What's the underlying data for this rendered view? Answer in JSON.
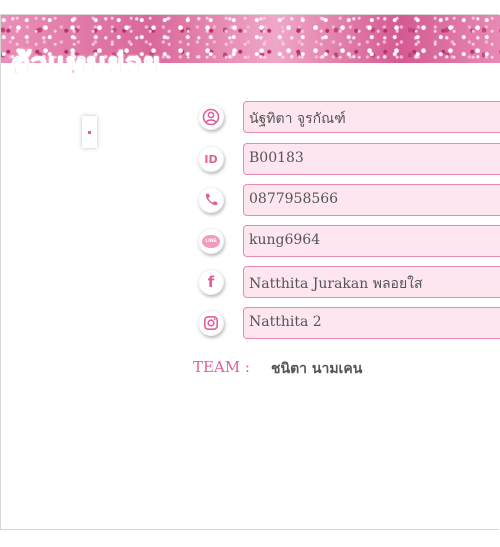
{
  "header": {
    "title": "ตัวแทนย่อย",
    "dot": "."
  },
  "colors": {
    "accent": "#e0609a",
    "field_bg": "#fde6ef",
    "field_border": "#ea8ab3"
  },
  "profile": {
    "fields": [
      {
        "icon": "user-icon",
        "value": "นัฐทิตา  จูรกัณฑ์"
      },
      {
        "icon": "id-icon",
        "value": "B00183"
      },
      {
        "icon": "phone-icon",
        "value": "0877958566"
      },
      {
        "icon": "line-icon",
        "icon_text": "LINE",
        "value": "kung6964"
      },
      {
        "icon": "facebook-icon",
        "icon_text": "f",
        "value": "Natthita Jurakan พลอยใส"
      },
      {
        "icon": "instagram-icon",
        "value": "Natthita 2"
      }
    ],
    "id_icon_text": "ID",
    "team_label": "TEAM :",
    "team_value": "ชนิตา นามเคน"
  }
}
